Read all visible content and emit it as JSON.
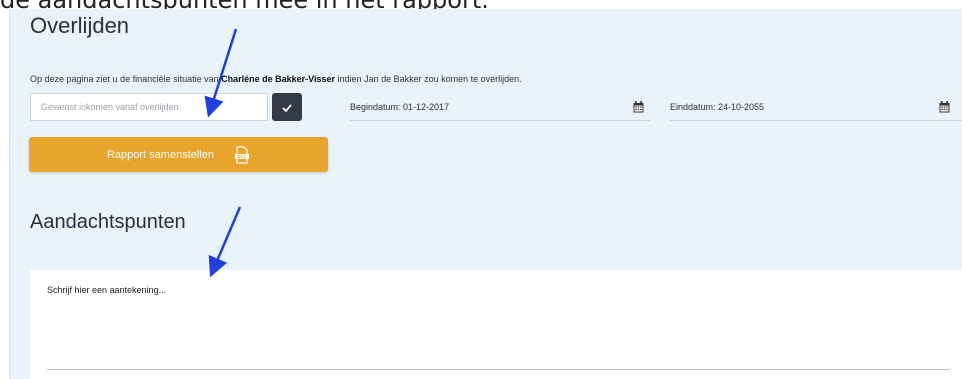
{
  "caption": "de aandachtspunten mee in het rapport.",
  "page": {
    "title": "Overlijden",
    "intro": {
      "before": "Op deze pagina ziet u de financiële situatie van ",
      "name": "Charléne de Bakker-Visser",
      "after": " indien Jan de Bakker zou komen te overlijden."
    }
  },
  "form": {
    "income_placeholder": "Gewenst inkomen vanaf overlijden",
    "start_date": "Begindatum: 01-12-2017",
    "end_date": "Einddatum: 24-10-2055",
    "report_button_label": "Rapport samenstellen"
  },
  "notes": {
    "title": "Aandachtspunten",
    "placeholder": "Schrijf hier een aantekening..."
  },
  "colors": {
    "panel": "#e8f3fb",
    "accent_orange": "#e8a52c",
    "dark_button": "#343a45",
    "annotation_arrow": "#1f3fe0"
  },
  "icons": {
    "check": "check-icon",
    "calendar": "calendar-icon",
    "document": "doc-file-icon"
  }
}
